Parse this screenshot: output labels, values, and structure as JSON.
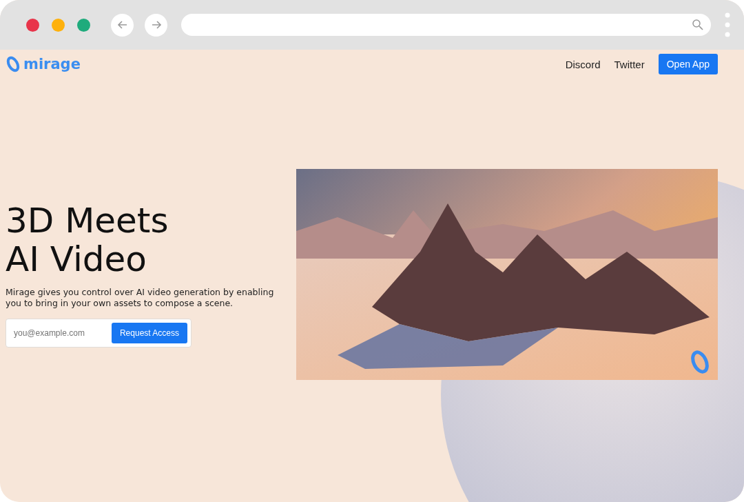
{
  "brand": {
    "name": "mirage"
  },
  "nav": {
    "links": [
      "Discord",
      "Twitter"
    ],
    "button": "Open App"
  },
  "hero": {
    "title_lines": [
      "3D Meets",
      "AI Video"
    ],
    "description": "Mirage gives you control over AI video generation by enabling you to bring in your own assets to compose a scene.",
    "email": {
      "placeholder": "you@example.com"
    },
    "button": "Request Access"
  }
}
